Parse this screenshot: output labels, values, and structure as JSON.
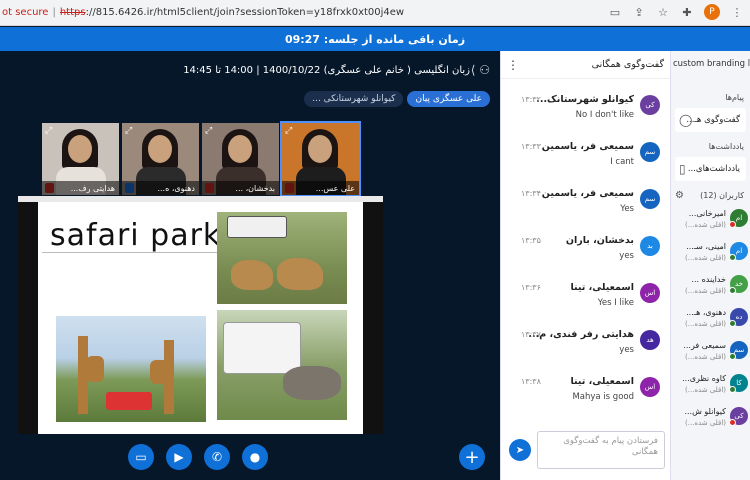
{
  "browser": {
    "security": "ot secure",
    "url_scheme": "https",
    "url_rest": "://815.6426.ir/html5client/join?sessionToken=y18frxk0xt00j4ew",
    "profile_letter": "P"
  },
  "banner": {
    "text": "زمان باقی مانده از جلسه: 09:27"
  },
  "class_info": {
    "title": "زبان انگلیسی ( خانم علی عسگری) 1400/10/22 | 14:00 تا 14:45"
  },
  "pills": [
    {
      "label": "علی عسگری پیان",
      "style": "blue"
    },
    {
      "label": "کیوانلو شهرستانکی ...",
      "style": "dark"
    }
  ],
  "webcams": [
    {
      "label": "هدایتی رف...",
      "mic": "muted"
    },
    {
      "label": "دهنوی، ه...",
      "mic": "on"
    },
    {
      "label": "بدخشان، ...",
      "mic": "muted"
    },
    {
      "label": "علی عس...",
      "mic": "muted",
      "active": true
    }
  ],
  "slide": {
    "title": "safari park"
  },
  "controls": [
    "screen-share-icon",
    "video-icon",
    "phone-icon",
    "microphone-icon"
  ],
  "chat": {
    "title": "گفت‌وگوی همگانی",
    "input_placeholder": "فرستادن پیام به گفت‌وگوی همگانی",
    "messages": [
      {
        "avatar": "کی",
        "color": "#6b3fa0",
        "name": "کیوانلو شهرستانک...",
        "time": "۱۳:۳۲",
        "text": "No I don't like"
      },
      {
        "avatar": "سم",
        "color": "#1565c0",
        "name": "سمیعی فر، یاسمین",
        "time": "۱۳:۳۳",
        "text": "I cant"
      },
      {
        "avatar": "سم",
        "color": "#1565c0",
        "name": "سمیعی فر، یاسمین",
        "time": "۱۳:۳۴",
        "text": "Yes"
      },
      {
        "avatar": "بد",
        "color": "#1e88e5",
        "name": "بدخشان، باران",
        "time": "۱۳:۳۵",
        "text": "yes"
      },
      {
        "avatar": "اس",
        "color": "#8e24aa",
        "name": "اسمعیلی، تینا",
        "time": "۱۳:۳۶",
        "text": "Yes I like"
      },
      {
        "avatar": "هد",
        "color": "#4527a0",
        "name": "هدایتی رفر فندی، م...",
        "time": "۱۳:۳۷",
        "text": "yes"
      },
      {
        "avatar": "اس",
        "color": "#8e24aa",
        "name": "اسمعیلی، تینا",
        "time": "۱۳:۳۸",
        "text": "Mahya is good"
      }
    ]
  },
  "sidebar": {
    "brand": "custom branding logo",
    "messages_heading": "پیام‌ها",
    "public_chat": "گفت‌وگوی هـ...",
    "notes_heading": "یادداشت‌ها",
    "shared_notes": "یادداشت‌های...",
    "users_heading": "کاربران (12)",
    "users": [
      {
        "avatar": "ام",
        "color": "#2e7d32",
        "name": "امیرخانی...",
        "sub": "(اقلی شده...)",
        "status": "#d93025"
      },
      {
        "avatar": "ام",
        "color": "#1e88e5",
        "name": "امینی، سـ...",
        "sub": "(اقلی شده...)",
        "status": "#2e7d32"
      },
      {
        "avatar": "خد",
        "color": "#43a047",
        "name": "خداینده ...",
        "sub": "(اقلی شده...)",
        "status": "#2e7d32"
      },
      {
        "avatar": "ده",
        "color": "#3949ab",
        "name": "دهنوی، هـ...",
        "sub": "(اقلی شده...)",
        "status": "#2e7d32"
      },
      {
        "avatar": "سم",
        "color": "#1565c0",
        "name": "سمیعی فر...",
        "sub": "(اقلی شده...)",
        "status": "#2e7d32"
      },
      {
        "avatar": "کا",
        "color": "#00838f",
        "name": "کاوه نظری...",
        "sub": "(اقلی شده...)",
        "status": "#2e7d32"
      },
      {
        "avatar": "کی",
        "color": "#6b3fa0",
        "name": "کیوانلو ش...",
        "sub": "(اقلی شده...)",
        "status": "#d93025"
      }
    ]
  },
  "colors": {
    "accent": "#0f70d7",
    "banner": "#0f70d7",
    "background": "#06172a"
  }
}
